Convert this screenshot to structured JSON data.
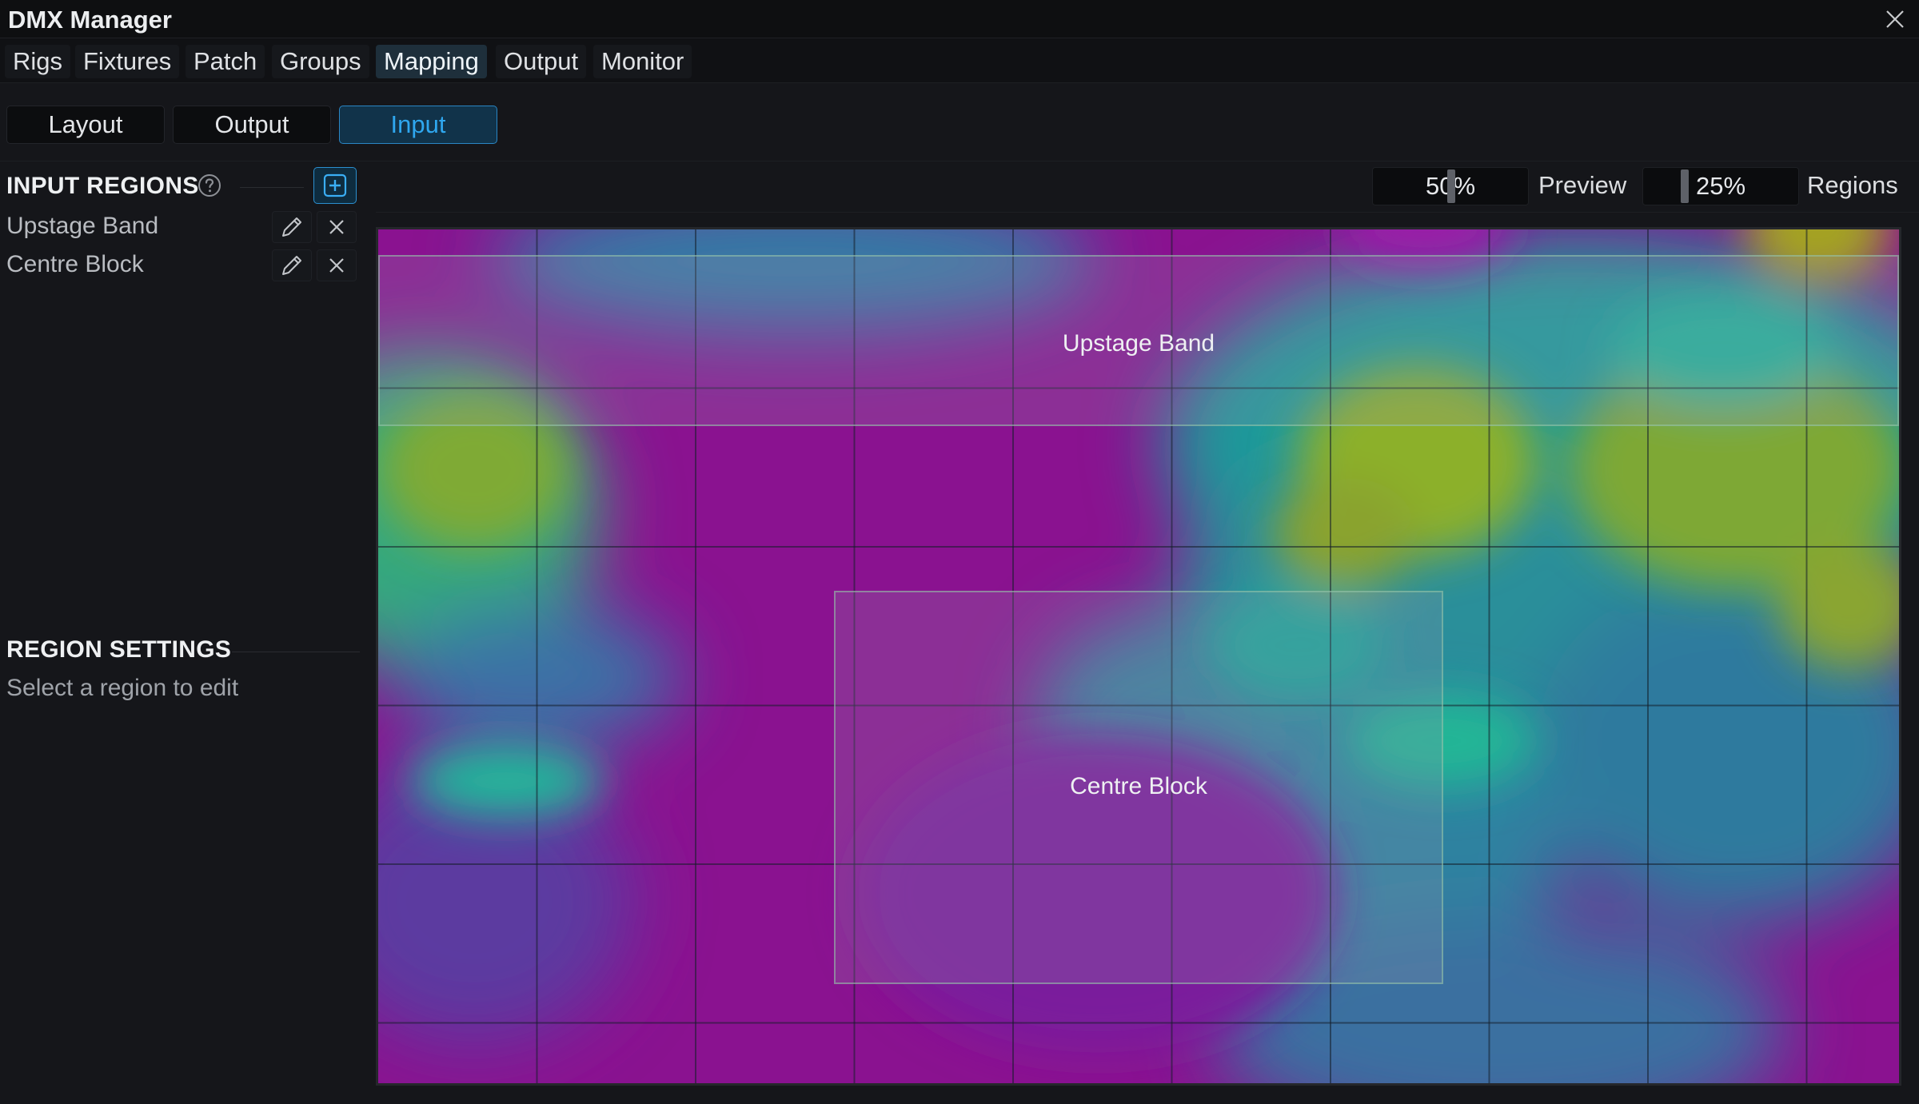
{
  "window": {
    "title": "DMX Manager"
  },
  "main_tabs": [
    {
      "label": "Rigs"
    },
    {
      "label": "Fixtures"
    },
    {
      "label": "Patch"
    },
    {
      "label": "Groups"
    },
    {
      "label": "Mapping",
      "active": true
    },
    {
      "label": "Output"
    },
    {
      "label": "Monitor"
    }
  ],
  "sub_tabs": [
    {
      "label": "Layout"
    },
    {
      "label": "Output"
    },
    {
      "label": "Input",
      "active": true
    }
  ],
  "sidebar": {
    "input_regions_title": "INPUT REGIONS",
    "regions": [
      {
        "label": "Upstage Band"
      },
      {
        "label": "Centre Block"
      }
    ],
    "region_settings_title": "REGION SETTINGS",
    "region_settings_hint": "Select a region to edit"
  },
  "zoom": {
    "preview": {
      "value": "50%",
      "label": "Preview",
      "fraction": 0.5
    },
    "regions": {
      "value": "25%",
      "label": "Regions",
      "fraction": 0.25
    }
  },
  "canvas": {
    "regions": [
      {
        "name": "Upstage Band"
      },
      {
        "name": "Centre Block"
      }
    ]
  },
  "colors": {
    "accent": "#2fa7ef",
    "background": "#15161a",
    "magenta": "#8e0f8c",
    "teal": "#1aa89a",
    "yellow_green": "#8ab02a"
  },
  "icons": [
    "close-icon",
    "help-icon",
    "add-icon",
    "edit-icon",
    "delete-icon"
  ]
}
